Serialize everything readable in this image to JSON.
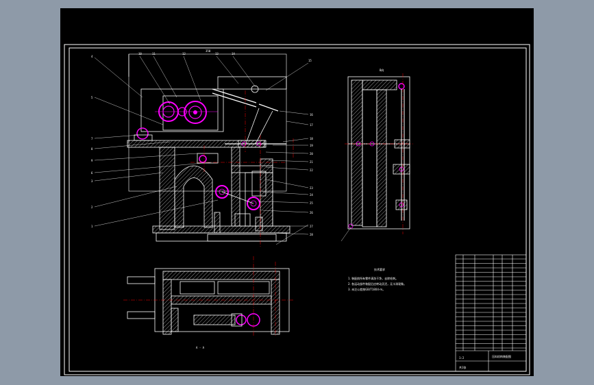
{
  "drawing": {
    "section_label": "A - A",
    "side_view_label": "B向",
    "notes_title": "技术要求",
    "notes_lines": [
      "1. 装配前所有零件清洗干净，去除毛刺。",
      "2. 各运动部件装配后应转动灵活，无卡滞现象。",
      "3. 未注公差按GB/T1804-m。"
    ],
    "callouts_left": [
      "4",
      "5",
      "7",
      "8",
      "9",
      "6",
      "3",
      "2",
      "1"
    ],
    "callouts_top": [
      "10",
      "11",
      "12",
      "13",
      "14",
      "15"
    ],
    "callouts_right": [
      "16",
      "17",
      "18",
      "19",
      "20",
      "21",
      "22",
      "23",
      "24",
      "25",
      "26",
      "27",
      "28"
    ],
    "dimension_top": "350",
    "title_block": {
      "drawing_title": "压料机构装配图",
      "scale": "1:2",
      "sheet": "共1张"
    }
  },
  "colors": {
    "background": "#000000",
    "frame": "#ffffff",
    "magenta": "#ff00ff",
    "red": "#ff0000",
    "window": "#8e9aa8"
  }
}
